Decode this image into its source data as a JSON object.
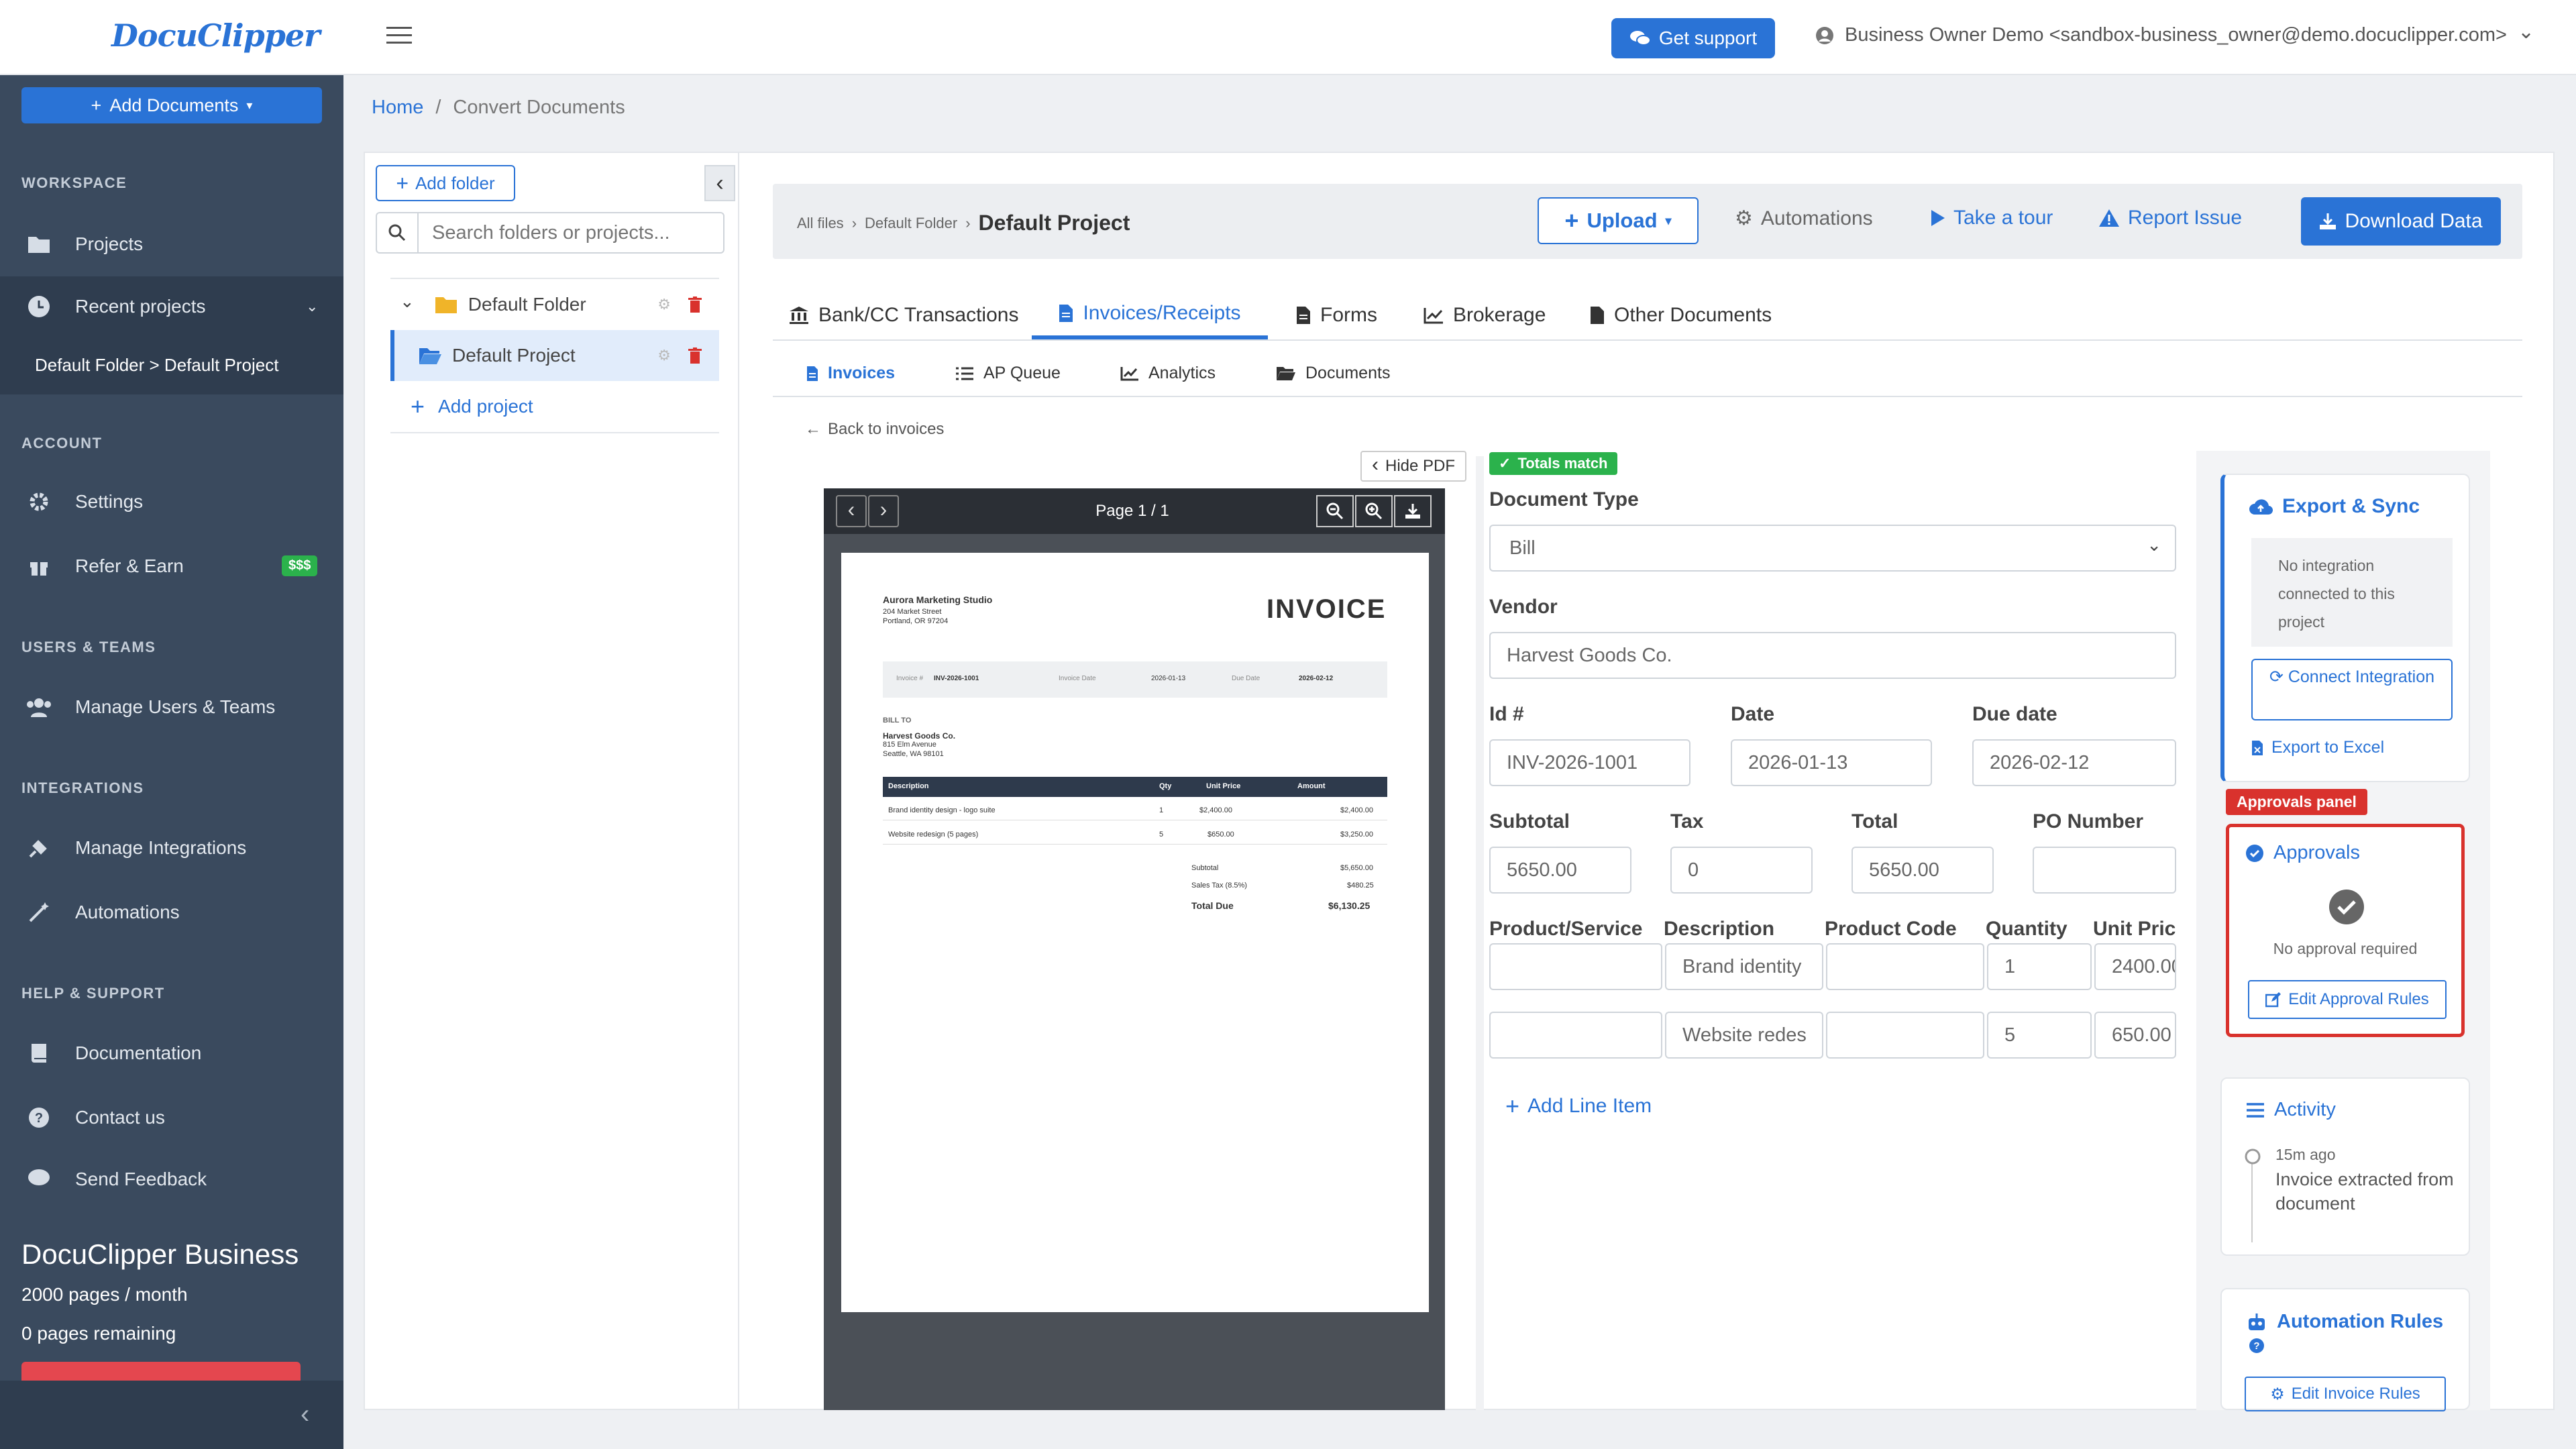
{
  "app": {
    "logo": "DocuClipper"
  },
  "sidebar": {
    "add_documents": "Add Documents",
    "sections": {
      "workspace": "WORKSPACE",
      "account": "ACCOUNT",
      "users": "USERS & TEAMS",
      "integrations": "INTEGRATIONS",
      "help": "HELP & SUPPORT"
    },
    "items": {
      "projects": "Projects",
      "recent": "Recent projects",
      "recent_sub": "Default Folder > Default Project",
      "settings": "Settings",
      "refer": "Refer & Earn",
      "refer_badge": "$$$",
      "manage_users": "Manage Users & Teams",
      "manage_integrations": "Manage Integrations",
      "automations": "Automations",
      "documentation": "Documentation",
      "contact": "Contact us",
      "feedback": "Send Feedback"
    },
    "plan": {
      "title": "DocuClipper Business",
      "pages": "2000 pages / month",
      "remaining": "0 pages remaining"
    }
  },
  "topbar": {
    "support": "Get support",
    "user": "Business Owner Demo <sandbox-business_owner@demo.docuclipper.com>"
  },
  "breadcrumb": {
    "home": "Home",
    "sep": "/",
    "current": "Convert Documents"
  },
  "folders": {
    "add_folder": "Add folder",
    "search_placeholder": "Search folders or projects...",
    "default_folder": "Default Folder",
    "default_project": "Default Project",
    "add_project": "Add project"
  },
  "header": {
    "crumb_all": "All files",
    "crumb_folder": "Default Folder",
    "crumb_project": "Default Project",
    "upload": "Upload",
    "automations": "Automations",
    "tour": "Take a tour",
    "report": "Report Issue",
    "download": "Download Data"
  },
  "tabs": {
    "bank": "Bank/CC Transactions",
    "invoices": "Invoices/Receipts",
    "forms": "Forms",
    "brokerage": "Brokerage",
    "other": "Other Documents"
  },
  "subtabs": {
    "invoices": "Invoices",
    "ap": "AP Queue",
    "analytics": "Analytics",
    "documents": "Documents"
  },
  "back": "Back to invoices",
  "pdf": {
    "hide": "Hide PDF",
    "page_label": "Page 1 / 1",
    "company": "Aurora Marketing Studio",
    "addr1": "204 Market Street",
    "addr2": "Portland, OR 97204",
    "title": "INVOICE",
    "meta_inv_label": "Invoice #",
    "meta_inv": "INV-2026-1001",
    "meta_date_label": "Invoice Date",
    "meta_date": "2026-01-13",
    "meta_due_label": "Due Date",
    "meta_due": "2026-02-12",
    "bill_to": "BILL TO",
    "client": "Harvest Goods Co.",
    "client_addr1": "815 Elm Avenue",
    "client_addr2": "Seattle, WA 98101",
    "cols": {
      "desc": "Description",
      "qty": "Qty",
      "price": "Unit Price",
      "amount": "Amount"
    },
    "rows": [
      {
        "desc": "Brand identity design - logo suite",
        "qty": "1",
        "price": "$2,400.00",
        "amount": "$2,400.00"
      },
      {
        "desc": "Website redesign (5 pages)",
        "qty": "5",
        "price": "$650.00",
        "amount": "$3,250.00"
      }
    ],
    "subtotal_label": "Subtotal",
    "subtotal": "$5,650.00",
    "tax_label": "Sales Tax (8.5%)",
    "tax": "$480.25",
    "total_label": "Total Due",
    "total": "$6,130.25"
  },
  "form": {
    "totals_badge": "Totals match",
    "doc_type_label": "Document Type",
    "doc_type": "Bill",
    "vendor_label": "Vendor",
    "vendor": "Harvest Goods Co.",
    "id_label": "Id #",
    "id": "INV-2026-1001",
    "date_label": "Date",
    "date": "2026-01-13",
    "due_label": "Due date",
    "due": "2026-02-12",
    "subtotal_label": "Subtotal",
    "subtotal": "5650.00",
    "tax_label": "Tax",
    "tax": "0",
    "total_label": "Total",
    "total": "5650.00",
    "po_label": "PO Number",
    "po": "",
    "li_product": "Product/Service",
    "li_desc": "Description",
    "li_code": "Product Code",
    "li_qty": "Quantity",
    "li_price": "Unit Price",
    "lines": [
      {
        "product": "",
        "desc": "Brand identity",
        "code": "",
        "qty": "1",
        "price": "2400.00"
      },
      {
        "product": "",
        "desc": "Website redes",
        "code": "",
        "qty": "5",
        "price": "650.00"
      }
    ],
    "add_line": "Add Line Item"
  },
  "right": {
    "export_title": "Export & Sync",
    "no_integration": "No integration connected to this project",
    "connect": "Connect Integration",
    "export_excel": "Export to Excel",
    "approvals_badge": "Approvals panel",
    "approvals_title": "Approvals",
    "no_approval": "No approval required",
    "edit_approval": "Edit Approval Rules",
    "activity_title": "Activity",
    "activity_time": "15m ago",
    "activity_text": "Invoice extracted from document",
    "automation_title": "Automation Rules",
    "edit_invoice_rules": "Edit Invoice Rules"
  },
  "colors": {
    "primary": "#2a73d6",
    "sidebar": "#3a4a5e",
    "success": "#2bb24c",
    "danger": "#d9322d"
  }
}
